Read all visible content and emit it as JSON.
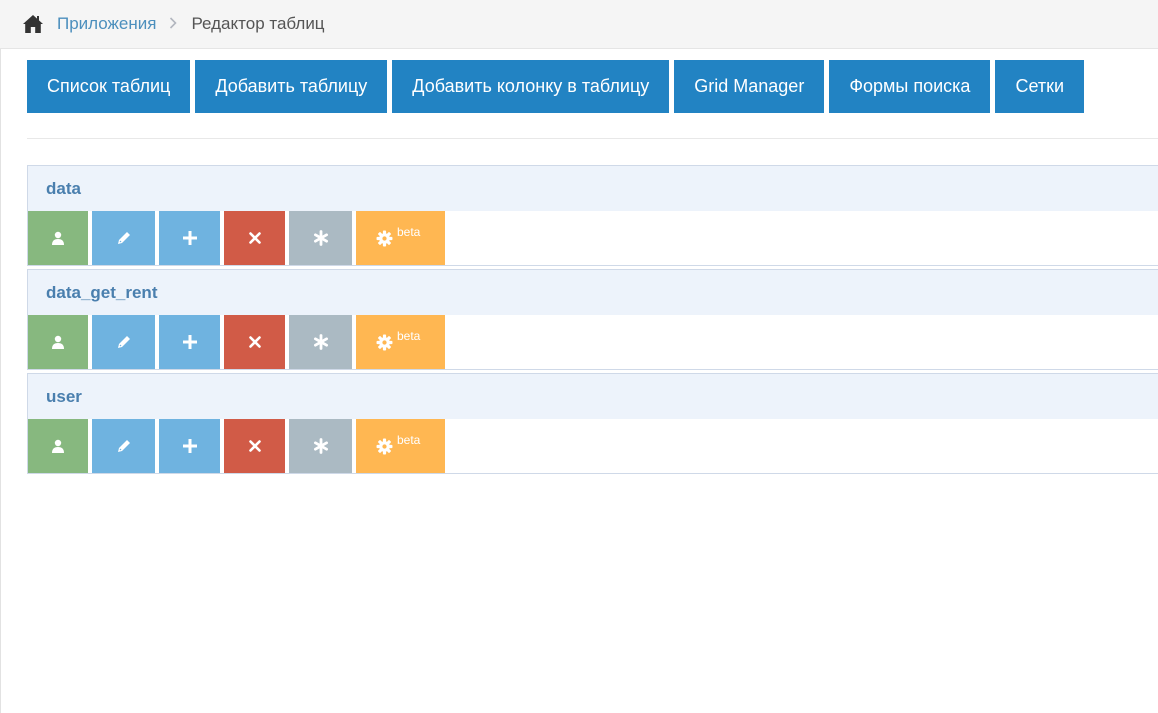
{
  "breadcrumb": {
    "home_icon": "home-icon",
    "link": "Приложения",
    "separator_icon": "chevron-right-icon",
    "current": "Редактор таблиц"
  },
  "toolbar": {
    "buttons": [
      {
        "label": "Список таблиц"
      },
      {
        "label": "Добавить таблицу"
      },
      {
        "label": "Добавить колонку в таблицу"
      },
      {
        "label": "Grid Manager"
      },
      {
        "label": "Формы поиска"
      },
      {
        "label": "Сетки"
      }
    ]
  },
  "tables": [
    {
      "name": "data"
    },
    {
      "name": "data_get_rent"
    },
    {
      "name": "user"
    }
  ],
  "actions": {
    "beta_label": "beta",
    "colors": {
      "user": "#87b87f",
      "edit": "#6fb3e0",
      "add": "#6fb3e0",
      "delete": "#d15b47",
      "star": "#abbac3",
      "beta": "#ffb752"
    },
    "icons": [
      "user-icon",
      "pencil-icon",
      "plus-icon",
      "times-icon",
      "asterisk-icon",
      "gear-icon"
    ]
  },
  "colors": {
    "primary": "#2283c3",
    "link": "#4c8fbd",
    "table_header_bg": "#edf3fb",
    "table_header_text": "#4a7fae"
  }
}
